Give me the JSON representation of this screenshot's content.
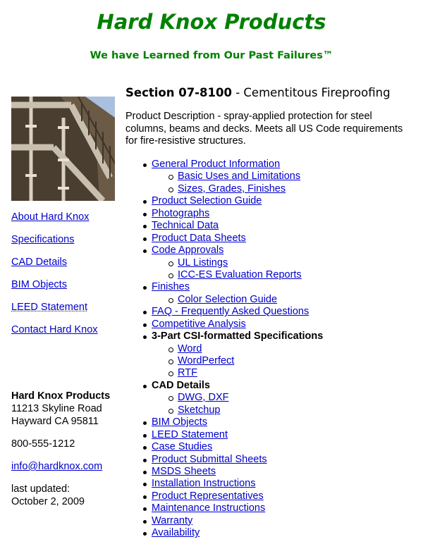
{
  "header": {
    "site_title": "Hard Knox Products",
    "tagline": "We have Learned from Our Past Failures™"
  },
  "colors": {
    "brand_green": "#008000",
    "link_blue": "#0000cc"
  },
  "photo": {
    "alt": "building-under-construction-photo"
  },
  "sidebar": {
    "links": [
      "About Hard Knox",
      "Specifications",
      "CAD Details",
      "BIM Objects",
      "LEED Statement",
      "Contact Hard Knox"
    ],
    "address": {
      "company": "Hard Knox Products",
      "street": "11213 Skyline Road",
      "city": "Hayward CA 95811",
      "phone": "800-555-1212",
      "email": "info@hardknox.com",
      "updated_label": "last updated:",
      "updated_date": "October 2, 2009"
    }
  },
  "main": {
    "section_code": "Section 07-8100",
    "section_title": " - Cementitous Fireproofing",
    "description": "Product Description - spray-applied protection for steel columns, beams and decks. Meets all US Code requirements for fire-resistive structures.",
    "toc": [
      {
        "label": "General Product Information",
        "level": 1,
        "link": true
      },
      {
        "label": "Basic Uses and Limitations",
        "level": 2,
        "link": true
      },
      {
        "label": "Sizes, Grades, Finishes",
        "level": 2,
        "link": true
      },
      {
        "label": "Product Selection Guide",
        "level": 1,
        "link": true
      },
      {
        "label": "Photographs",
        "level": 1,
        "link": true
      },
      {
        "label": "Technical Data",
        "level": 1,
        "link": true
      },
      {
        "label": "Product Data Sheets",
        "level": 1,
        "link": true
      },
      {
        "label": "Code Approvals",
        "level": 1,
        "link": true
      },
      {
        "label": "UL Listings",
        "level": 2,
        "link": true
      },
      {
        "label": "ICC-ES Evaluation Reports",
        "level": 2,
        "link": true
      },
      {
        "label": "Finishes",
        "level": 1,
        "link": true
      },
      {
        "label": "Color Selection Guide",
        "level": 2,
        "link": true
      },
      {
        "label": "FAQ - Frequently Asked Questions",
        "level": 1,
        "link": true
      },
      {
        "label": "Competitive Analysis",
        "level": 1,
        "link": true
      },
      {
        "label": "3-Part CSI-formatted Specifications",
        "level": 1,
        "link": false
      },
      {
        "label": "Word",
        "level": 2,
        "link": true
      },
      {
        "label": "WordPerfect",
        "level": 2,
        "link": true
      },
      {
        "label": "RTF",
        "level": 2,
        "link": true
      },
      {
        "label": "CAD Details",
        "level": 1,
        "link": false
      },
      {
        "label": "DWG, DXF",
        "level": 2,
        "link": true
      },
      {
        "label": "Sketchup",
        "level": 2,
        "link": true
      },
      {
        "label": "BIM Objects",
        "level": 1,
        "link": true
      },
      {
        "label": "LEED Statement",
        "level": 1,
        "link": true
      },
      {
        "label": "Case Studies",
        "level": 1,
        "link": true
      },
      {
        "label": "Product Submittal Sheets",
        "level": 1,
        "link": true
      },
      {
        "label": "MSDS Sheets",
        "level": 1,
        "link": true
      },
      {
        "label": "Installation Instructions",
        "level": 1,
        "link": true
      },
      {
        "label": "Product Representatives",
        "level": 1,
        "link": true
      },
      {
        "label": "Maintenance Instructions",
        "level": 1,
        "link": true
      },
      {
        "label": "Warranty",
        "level": 1,
        "link": true
      },
      {
        "label": "Availability",
        "level": 1,
        "link": true
      }
    ]
  }
}
